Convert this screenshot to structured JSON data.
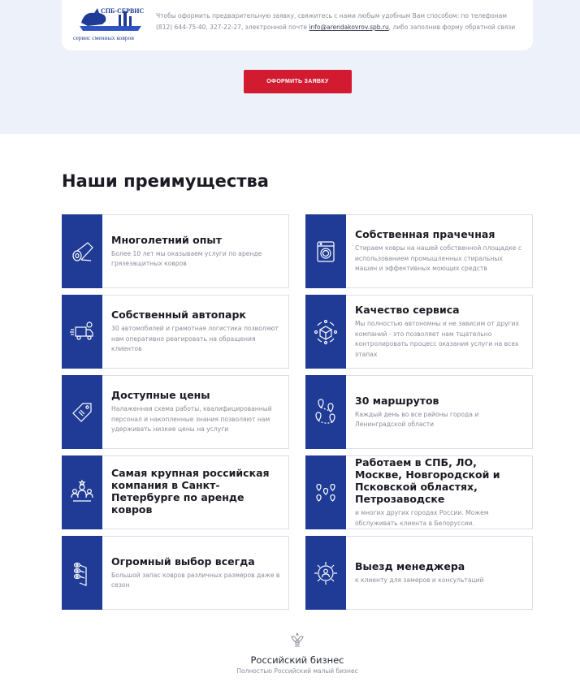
{
  "contact": {
    "logo_top_text": "СПБ-СЕРВИС",
    "logo_bottom_text": "сервис сменных ковров",
    "text_before_email": "Чтобы оформить предварительную заявку, свяжитесь с нами любым удобным Вам способом: по телефонам (812) 644-75-40, 327-22-27, электронной почте",
    "email": "info@arendakovrov.spb.ru",
    "text_after_email": ", либо заполнив форму обратной связи"
  },
  "order_button": {
    "label": "ОФОРМИТЬ ЗАЯВКУ"
  },
  "advantages": {
    "title": "Наши преимущества",
    "items": [
      {
        "title": "Многолетний опыт",
        "desc": "Более 10 лет мы оказываем услуги по аренде грязезащитных ковров",
        "icon": "carpet-roll-icon"
      },
      {
        "title": "Собственная прачечная",
        "desc": "Стираем ковры на нашей собственной площадке с использованием промышленных стиральных машин и эффективных моющих средств",
        "icon": "washing-machine-icon"
      },
      {
        "title": "Собственный автопарк",
        "desc": "30 автомобилей и грамотная логистика позволяют нам оперативно реагировать на обращения клиентов",
        "icon": "delivery-truck-icon"
      },
      {
        "title": "Качество сервиса",
        "desc": "Мы полностью автономны и не зависим от других компаний - это позволяет нам тщательно контролировать процесс оказания услуги на всех этапах",
        "icon": "quality-box-icon"
      },
      {
        "title": "Доступные цены",
        "desc": "Налаженная схема работы, квалифицированный персонал и накопленные знания позволяют нам удерживать низкие цены на услуги",
        "icon": "price-tag-icon"
      },
      {
        "title": "30 маршрутов",
        "desc": "Каждый день во все районы города и Ленинградской области",
        "icon": "route-map-icon"
      },
      {
        "title": "Самая крупная российская компания в Санкт-Петербурге по аренде ковров",
        "desc": "",
        "icon": "team-icon"
      },
      {
        "title": "Работаем в СПБ, ЛО, Москве, Новгородской и Псковской областях, Петрозаводске",
        "desc": "и многих других городах России. Можем обслуживать клиента в Белоруссии.",
        "icon": "location-pins-icon"
      },
      {
        "title": "Огромный выбор всегда",
        "desc": "Большой запас ковров различных размеров даже в сезон",
        "icon": "carpet-stack-icon"
      },
      {
        "title": "Выезд менеджера",
        "desc": "к клиенту для замеров и консультаций",
        "icon": "gear-person-icon"
      }
    ]
  },
  "footer": {
    "title": "Российский бизнес",
    "subtitle": "Полностью Российский малый бизнес",
    "icon": "emblem-icon"
  }
}
